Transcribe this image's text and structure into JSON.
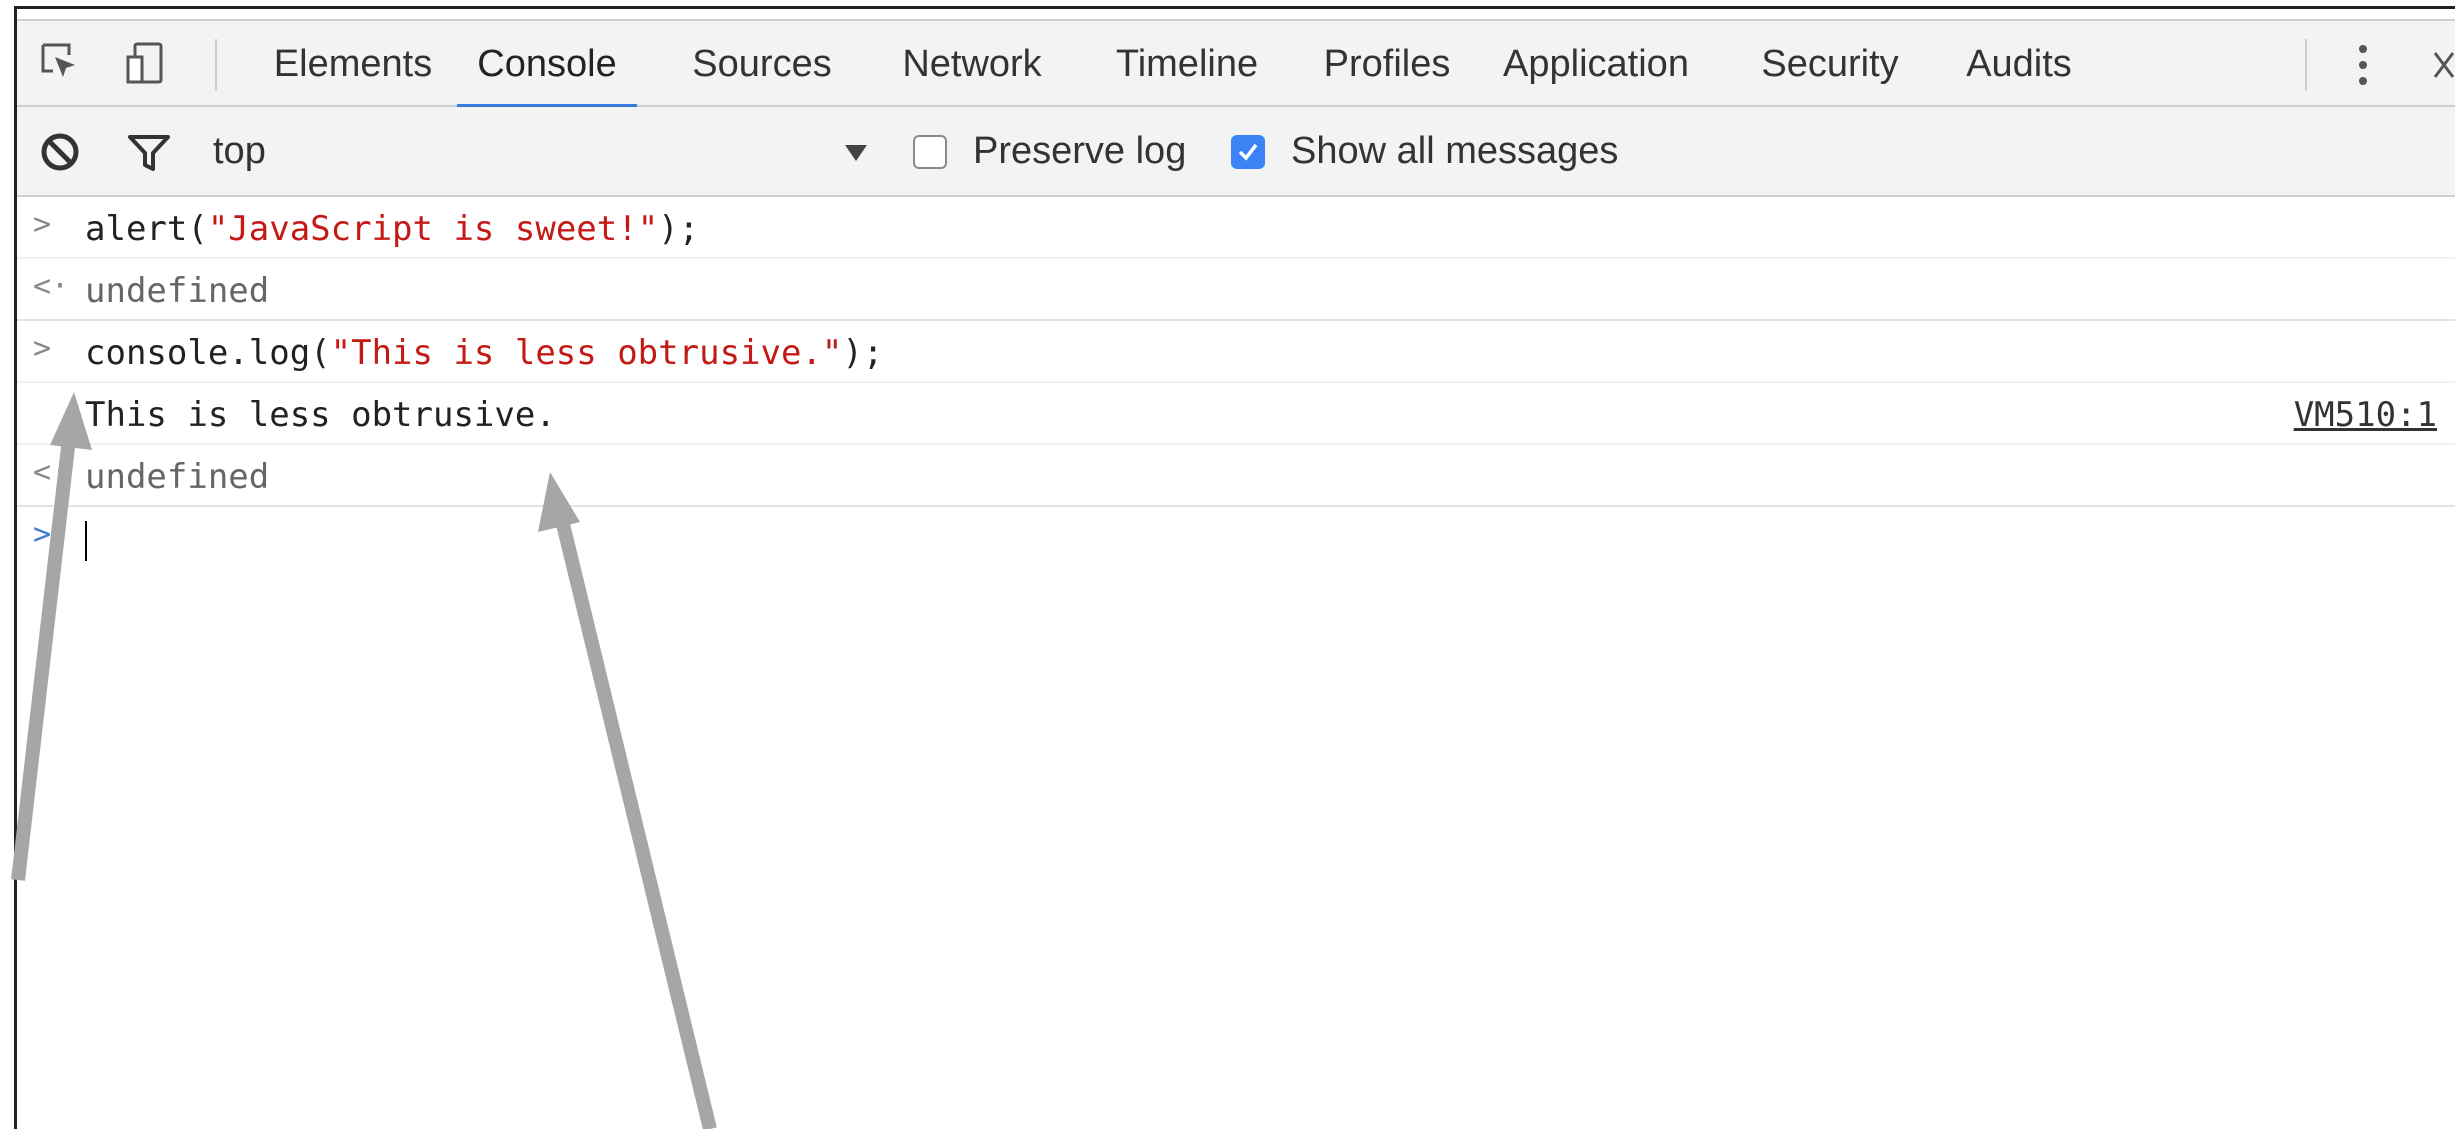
{
  "toolbar": {
    "inspect_icon": "element-picker-icon",
    "device_icon": "device-mode-icon",
    "tabs": [
      "Elements",
      "Console",
      "Sources",
      "Network",
      "Timeline",
      "Profiles",
      "Application",
      "Security",
      "Audits"
    ],
    "active_tab": "Console",
    "more_icon": "kebab-menu-icon",
    "close_icon": "close-icon"
  },
  "filterbar": {
    "clear_icon": "clear-console-icon",
    "filter_icon": "filter-icon",
    "context": "top",
    "preserve_log": {
      "label": "Preserve log",
      "checked": false
    },
    "show_all": {
      "label": "Show all messages",
      "checked": true
    }
  },
  "console": {
    "lines": [
      {
        "kind": "input",
        "before": "alert(",
        "string": "\"JavaScript is sweet!\"",
        "after": ");"
      },
      {
        "kind": "result",
        "text": "undefined"
      },
      {
        "kind": "input",
        "before": "console.log(",
        "string": "\"This is less obtrusive.\"",
        "after": ");"
      },
      {
        "kind": "log",
        "text": "This is less obtrusive.",
        "source": "VM510:1"
      },
      {
        "kind": "result",
        "text": "undefined"
      }
    ]
  },
  "colors": {
    "accent": "#3879d9",
    "string": "#c41a16",
    "toolbar_bg": "#f3f3f3",
    "arrow": "#a6a6a6"
  }
}
